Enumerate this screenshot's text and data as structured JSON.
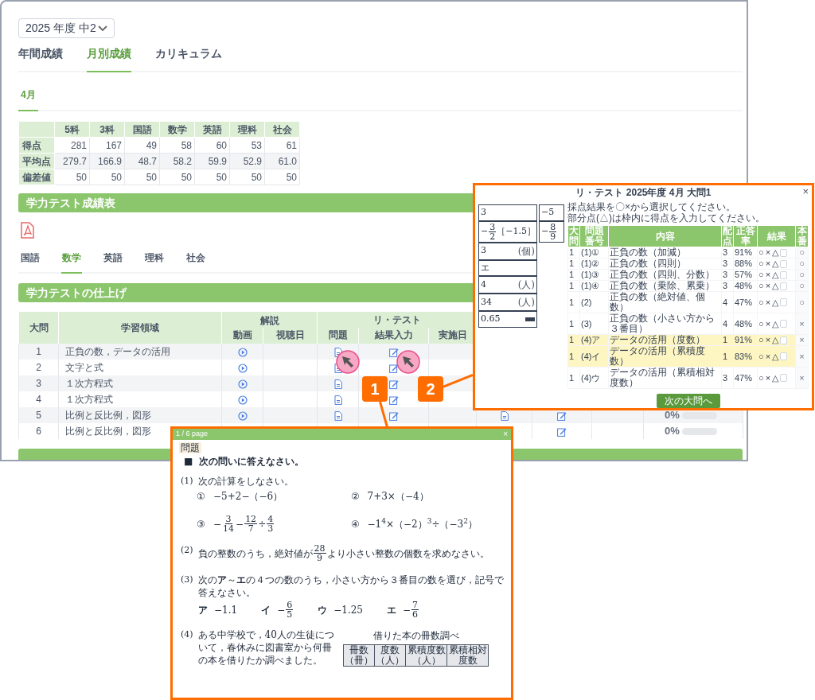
{
  "year_select": {
    "value": "2025 年度 中2"
  },
  "main_tabs": [
    {
      "label": "年間成績",
      "selected": false
    },
    {
      "label": "月別成績",
      "selected": true
    },
    {
      "label": "カリキュラム",
      "selected": false
    }
  ],
  "month_tabs": [
    {
      "label": "4月",
      "selected": true
    }
  ],
  "score_table": {
    "columns": [
      "5科",
      "3科",
      "国語",
      "数学",
      "英語",
      "理科",
      "社会"
    ],
    "rows": [
      {
        "label": "得点",
        "cells": [
          "281",
          "167",
          "49",
          "58",
          "60",
          "53",
          "61"
        ]
      },
      {
        "label": "平均点",
        "cells": [
          "279.7",
          "166.9",
          "48.7",
          "58.2",
          "59.9",
          "52.9",
          "61.0"
        ]
      },
      {
        "label": "偏差値",
        "cells": [
          "50",
          "50",
          "50",
          "50",
          "50",
          "50",
          "50"
        ]
      }
    ]
  },
  "report_section": {
    "title": "学力テスト成績表"
  },
  "subject_tabs": [
    {
      "label": "国語",
      "selected": false
    },
    {
      "label": "数学",
      "selected": true
    },
    {
      "label": "英語",
      "selected": false
    },
    {
      "label": "理科",
      "selected": false
    },
    {
      "label": "社会",
      "selected": false
    }
  ],
  "finish_section": {
    "title": "学力テストの仕上げ",
    "columns": {
      "number": "大問",
      "area": "学習領域",
      "commentary": "解説",
      "video": "動画",
      "watched": "視聴日",
      "retest": "リ・テスト",
      "problem": "問題",
      "result": "結果入力",
      "date": "実施日"
    },
    "rows": [
      {
        "number": "1",
        "area": "正負の数，データの活用",
        "icons": true
      },
      {
        "number": "2",
        "area": "文字と式",
        "icons": true
      },
      {
        "number": "3",
        "area": "１次方程式",
        "icons": true
      },
      {
        "number": "4",
        "area": "１次方程式",
        "icons": true
      },
      {
        "number": "5",
        "area": "比例と反比例，図形",
        "icons": true,
        "extra": {
          "problem": true,
          "edit": true,
          "progress": "0%",
          "level": 0
        }
      },
      {
        "number": "6",
        "area": "比例と反比例，図形",
        "icons": false,
        "extra": {
          "problem": false,
          "edit": true,
          "progress": "0%",
          "level": 0
        }
      }
    ]
  },
  "retest_dialog": {
    "title": "リ・テスト 2025年度 4月 大問1",
    "close": "×",
    "answers_left": [
      {
        "parts": [
          "3"
        ]
      },
      {
        "parts": [
          "−",
          {
            "num": "3",
            "den": "2"
          },
          "［−1.5］"
        ]
      },
      {
        "parts": [
          "3"
        ],
        "unit": "(個)"
      },
      {
        "parts": [
          "エ"
        ]
      },
      {
        "parts": [
          "4"
        ],
        "unit": "(人)"
      },
      {
        "parts": [
          "34"
        ],
        "unit": "(人)"
      },
      {
        "parts": [
          "0.65"
        ],
        "stamp": true
      }
    ],
    "answers_right": [
      {
        "parts": [
          "−5"
        ]
      },
      {
        "parts": [
          "−",
          {
            "num": "8",
            "den": "9"
          }
        ]
      }
    ],
    "instructions": [
      "採点結果を〇×から選択してください。",
      "部分点(△)は枠内に得点を入力してください。"
    ],
    "columns": [
      "大問",
      "問題番号",
      "内容",
      "配点",
      "正答率",
      "結果",
      "本番"
    ],
    "rows": [
      {
        "q": "1",
        "no": "(1)①",
        "content": "正負の数（加減）",
        "points": "3",
        "rate": "91%",
        "marks": [
          "○",
          "×",
          "△"
        ],
        "original": "○",
        "highlighted": false
      },
      {
        "q": "1",
        "no": "(1)②",
        "content": "正負の数（四則）",
        "points": "3",
        "rate": "88%",
        "marks": [
          "○",
          "×",
          "△"
        ],
        "original": "○",
        "highlighted": false
      },
      {
        "q": "1",
        "no": "(1)③",
        "content": "正負の数（四則、分数）",
        "points": "3",
        "rate": "57%",
        "marks": [
          "○",
          "×",
          "△"
        ],
        "original": "○",
        "highlighted": false
      },
      {
        "q": "1",
        "no": "(1)④",
        "content": "正負の数（乗除、累乗）",
        "points": "3",
        "rate": "48%",
        "marks": [
          "○",
          "×",
          "△"
        ],
        "original": "○",
        "highlighted": false
      },
      {
        "q": "1",
        "no": "(2)",
        "content": "正負の数（絶対値、個数）",
        "points": "4",
        "rate": "47%",
        "marks": [
          "○",
          "×",
          "△"
        ],
        "original": "○",
        "highlighted": false
      },
      {
        "q": "1",
        "no": "(3)",
        "content": "正負の数（小さい方から３番目）",
        "points": "4",
        "rate": "48%",
        "marks": [
          "○",
          "×",
          "△"
        ],
        "original": "×",
        "highlighted": false
      },
      {
        "q": "1",
        "no": "(4)ア",
        "content": "データの活用（度数）",
        "points": "1",
        "rate": "91%",
        "marks": [
          "○",
          "×",
          "△"
        ],
        "original": "×",
        "highlighted": true
      },
      {
        "q": "1",
        "no": "(4)イ",
        "content": "データの活用（累積度数）",
        "points": "1",
        "rate": "83%",
        "marks": [
          "○",
          "×",
          "△"
        ],
        "original": "×",
        "highlighted": true
      },
      {
        "q": "1",
        "no": "(4)ウ",
        "content": "データの活用（累積相対度数）",
        "points": "3",
        "rate": "47%",
        "marks": [
          "○",
          "×",
          "△"
        ],
        "original": "×",
        "highlighted": false
      }
    ],
    "next_button": "次の大問へ"
  },
  "callouts": [
    {
      "number": "1"
    },
    {
      "number": "2"
    }
  ],
  "problem_dialog": {
    "title": "1 / 6 page",
    "close": "×",
    "tag": "問題",
    "heading_mark": "■",
    "heading": "次の問いに答えなさい。",
    "blocks": [
      {
        "kind": "text",
        "label": "(1)",
        "text": "次の計算をしなさい。"
      },
      {
        "kind": "pair",
        "items": [
          {
            "label": "①",
            "parts": [
              "−5+2−（−6）"
            ]
          },
          {
            "label": "②",
            "parts": [
              "7+3×（−4）"
            ]
          }
        ]
      },
      {
        "kind": "pair",
        "items": [
          {
            "label": "③",
            "parts": [
              "−",
              {
                "num": "3",
                "den": "14"
              },
              "−",
              {
                "num": "12",
                "den": "7"
              },
              "÷",
              {
                "num": "4",
                "den": "3"
              }
            ]
          },
          {
            "label": "④",
            "parts": [
              "−1$^{4}$×（−2）$^{3}$÷（−3$^{2}$）"
            ]
          }
        ]
      },
      {
        "kind": "math",
        "label": "(2)",
        "parts": [
          "負の整数のうち，絶対値が",
          {
            "num": "28",
            "den": "9"
          },
          "より小さい整数の個数を求めなさい。"
        ]
      },
      {
        "kind": "text",
        "label": "(3)",
        "text": "次の**ア**～**エ**の４つの数のうち，小さい方から３番目の数を選び，記号で答えなさい。"
      },
      {
        "kind": "options",
        "items": [
          {
            "label": "ア",
            "parts": [
              "−1.1"
            ]
          },
          {
            "label": "イ",
            "parts": [
              "−",
              {
                "num": "6",
                "den": "5"
              }
            ]
          },
          {
            "label": "ウ",
            "parts": [
              "−1.25"
            ]
          },
          {
            "label": "エ",
            "parts": [
              "−",
              {
                "num": "7",
                "den": "6"
              }
            ]
          }
        ]
      },
      {
        "kind": "survey",
        "label": "(4)",
        "text": "ある中学校で，40人の生徒について，春休みに図書室から何冊の本を借りたか調べました。",
        "table_title": "借りた本の冊数調べ",
        "columns": [
          "冊数（冊）",
          "度数（人）",
          "累積度数（人）",
          "累積相対度数"
        ]
      }
    ]
  }
}
